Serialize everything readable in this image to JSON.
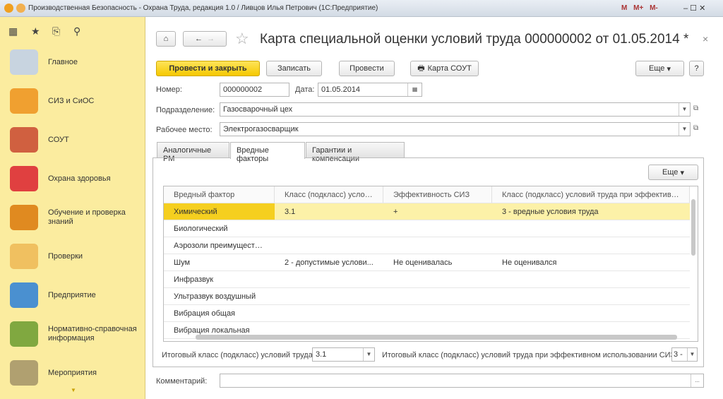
{
  "window": {
    "title": "Производственная Безопасность - Охрана Труда, редакция 1.0 / Ливцов Илья Петрович  (1С:Предприятие)",
    "toolbar_icons": [
      "M",
      "M+",
      "M-"
    ]
  },
  "sidebar": {
    "items": [
      {
        "label": "Главное",
        "color": "#c8d4e0"
      },
      {
        "label": "СИЗ и СиОС",
        "color": "#f0a030"
      },
      {
        "label": "СОУТ",
        "color": "#d06040"
      },
      {
        "label": "Охрана здоровья",
        "color": "#e04040"
      },
      {
        "label": "Обучение и проверка знаний",
        "color": "#e08a20"
      },
      {
        "label": "Проверки",
        "color": "#f0c060"
      },
      {
        "label": "Предприятие",
        "color": "#4a90d0"
      },
      {
        "label": "Нормативно-справочная информация",
        "color": "#80a840"
      },
      {
        "label": "Мероприятия",
        "color": "#b0a070"
      }
    ]
  },
  "header": {
    "title": "Карта специальной оценки условий труда 000000002 от 01.05.2014 *",
    "close": "×"
  },
  "toolbar": {
    "post_close": "Провести и закрыть",
    "save": "Записать",
    "post": "Провести",
    "card": "Карта СОУТ",
    "more": "Еще",
    "help": "?"
  },
  "form": {
    "number_label": "Номер:",
    "number": "000000002",
    "date_label": "Дата:",
    "date": "01.05.2014",
    "division_label": "Подразделение:",
    "division": "Газосварочный цех",
    "workplace_label": "Рабочее место:",
    "workplace": "Электрогазосварщик"
  },
  "tabs": [
    "Аналогичные РМ",
    "Вредные факторы",
    "Гарантии и компенсации"
  ],
  "grid": {
    "more": "Еще",
    "columns": [
      "Вредный фактор",
      "Класс (подкласс) услов...",
      "Эффективность СИЗ",
      "Класс (подкласс) условий труда при эффективн..."
    ],
    "rows": [
      [
        "Химический",
        "3.1",
        "+",
        "3 - вредные условия труда"
      ],
      [
        "Биологический",
        "",
        "",
        ""
      ],
      [
        "Аэрозоли преимуществ...",
        "",
        "",
        ""
      ],
      [
        "Шум",
        "2 - допустимые услови...",
        "Не оценивалась",
        "Не оценивался"
      ],
      [
        "Инфразвук",
        "",
        "",
        ""
      ],
      [
        "Ультразвук воздушный",
        "",
        "",
        ""
      ],
      [
        "Вибрация общая",
        "",
        "",
        ""
      ],
      [
        "Вибрация локальная",
        "",
        "",
        ""
      ]
    ]
  },
  "totals": {
    "label1": "Итоговый класс (подкласс) условий труда:",
    "value1": "3.1",
    "label2": "Итоговый класс (подкласс) условий труда при эффективном использовании СИЗ:",
    "value2": "3 -"
  },
  "comment": {
    "label": "Комментарий:",
    "value": "",
    "button": "..."
  }
}
